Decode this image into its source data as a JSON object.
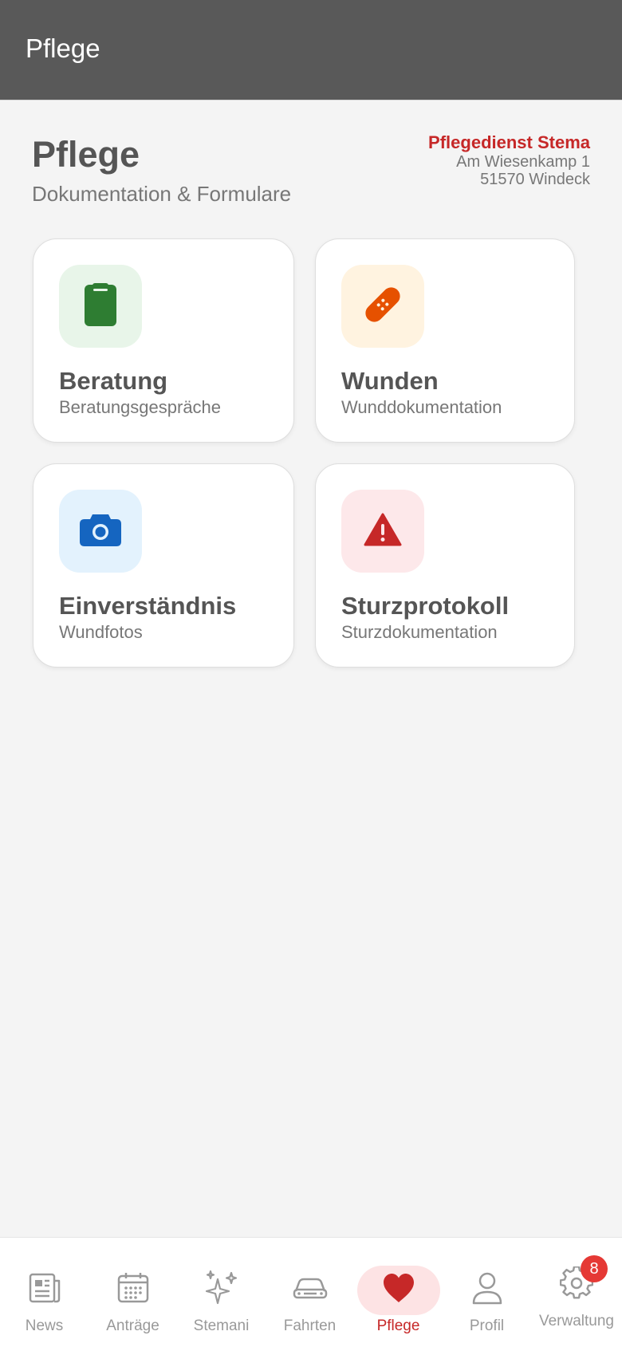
{
  "appbar": {
    "title": "Pflege"
  },
  "header": {
    "title": "Pflege",
    "subtitle": "Dokumentation & Formulare",
    "company": {
      "name": "Pflegedienst Stema",
      "street": "Am Wiesenkamp 1",
      "city": "51570 Windeck"
    }
  },
  "cards": [
    {
      "title": "Beratung",
      "subtitle": "Beratungsgespräche",
      "icon": "clipboard-icon",
      "accent": "#2e7d32",
      "bg": "#e8f5e9"
    },
    {
      "title": "Wunden",
      "subtitle": "Wunddokumentation",
      "icon": "bandage-icon",
      "accent": "#e65100",
      "bg": "#fff3e0"
    },
    {
      "title": "Einverständnis",
      "subtitle": "Wundfotos",
      "icon": "camera-icon",
      "accent": "#1565c0",
      "bg": "#e3f2fd"
    },
    {
      "title": "Sturzprotokoll",
      "subtitle": "Sturzdokumentation",
      "icon": "warning-icon",
      "accent": "#c62828",
      "bg": "#fde8ea"
    }
  ],
  "nav": {
    "items": [
      {
        "label": "News",
        "icon": "newspaper-icon"
      },
      {
        "label": "Anträge",
        "icon": "calendar-icon"
      },
      {
        "label": "Stemani",
        "icon": "sparkles-icon"
      },
      {
        "label": "Fahrten",
        "icon": "car-icon"
      },
      {
        "label": "Pflege",
        "icon": "heart-icon",
        "active": true
      },
      {
        "label": "Profil",
        "icon": "person-icon"
      },
      {
        "label": "Verwaltung",
        "icon": "gear-icon",
        "badge": "8"
      }
    ]
  },
  "colors": {
    "appbar": "#595959",
    "brand_red": "#c62828",
    "background": "#f4f4f4"
  }
}
